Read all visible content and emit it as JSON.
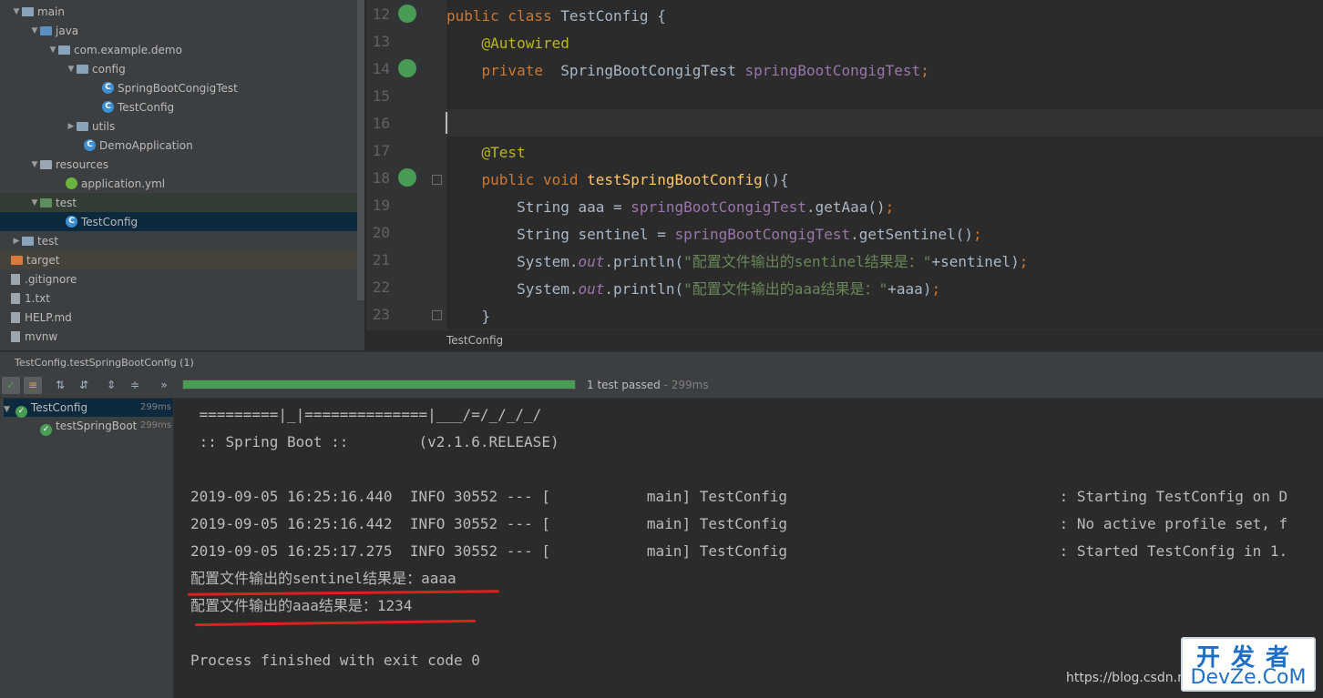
{
  "tree": {
    "items": [
      {
        "label": "main",
        "type": "folder"
      },
      {
        "label": "java",
        "type": "src"
      },
      {
        "label": "com.example.demo",
        "type": "package"
      },
      {
        "label": "config",
        "type": "package"
      },
      {
        "label": "SpringBootCongigTest",
        "type": "class"
      },
      {
        "label": "TestConfig",
        "type": "class"
      },
      {
        "label": "utils",
        "type": "package"
      },
      {
        "label": "DemoApplication",
        "type": "class"
      },
      {
        "label": "resources",
        "type": "res"
      },
      {
        "label": "application.yml",
        "type": "yml"
      },
      {
        "label": "test",
        "type": "green"
      },
      {
        "label": "TestConfig",
        "type": "class",
        "selected": true
      },
      {
        "label": "test",
        "type": "folder"
      },
      {
        "label": "target",
        "type": "orange"
      },
      {
        "label": ".gitignore",
        "type": "file"
      },
      {
        "label": "1.txt",
        "type": "file"
      },
      {
        "label": "HELP.md",
        "type": "file"
      },
      {
        "label": "mvnw",
        "type": "file"
      }
    ]
  },
  "editor": {
    "line_numbers": [
      "12",
      "13",
      "14",
      "15",
      "16",
      "17",
      "18",
      "19",
      "20",
      "21",
      "22",
      "23"
    ],
    "code": {
      "l12a": "public class ",
      "l12b": "TestConfig {",
      "l13": "@Autowired",
      "l14a": "private  ",
      "l14b": "SpringBootCongigTest ",
      "l14c": "springBootCongigTest",
      ";": ";",
      "l17": "@Test",
      "l18a": "public void ",
      "l18b": "testSpringBootConfig",
      "l18c": "(){",
      "l19a": "String aaa = ",
      "l19b": "springBootCongigTest",
      ".getAaa()": ".getAaa()",
      "l20a": "String sentinel = ",
      "l20b": "springBootCongigTest",
      ".getSentinel()": ".getSentinel()",
      "sys": "System.",
      "out": "out",
      ".println(": ".println(",
      "str21": "\"配置文件输出的sentinel结果是：\"",
      "plus21": "+sentinel)",
      "str22": "\"配置文件输出的aaa结果是：\"",
      "plus22": "+aaa)",
      "l23": "}"
    },
    "breadcrumb": "TestConfig"
  },
  "run": {
    "title": "TestConfig.testSpringBootConfig (1)",
    "progress": 1.0,
    "status_text": "1 test passed",
    "status_time": "- 299ms",
    "tests": [
      {
        "label": "TestConfig",
        "time": "299ms"
      },
      {
        "label": "testSpringBoot",
        "time": "299ms"
      }
    ],
    "console": [
      " =========|_|==============|___/=/_/_/_/",
      " :: Spring Boot ::        (v2.1.6.RELEASE)",
      "",
      "2019-09-05 16:25:16.440  INFO 30552 --- [           main] TestConfig                               : Starting TestConfig on D",
      "2019-09-05 16:25:16.442  INFO 30552 --- [           main] TestConfig                               : No active profile set, f",
      "2019-09-05 16:25:17.275  INFO 30552 --- [           main] TestConfig                               : Started TestConfig in 1.",
      "配置文件输出的sentinel结果是：aaaa",
      "配置文件输出的aaa结果是：1234",
      "",
      "Process finished with exit code 0"
    ]
  },
  "watermark": {
    "url": "https://blog.csdn.n",
    "logo_top": "开发者",
    "logo_bottom": "DevZe.CoM"
  },
  "colors": {
    "keyword": "#cc7832",
    "annotation": "#bbb529",
    "field": "#9876aa",
    "method": "#ffc66d",
    "string": "#6a8759",
    "pass": "#499c54"
  }
}
